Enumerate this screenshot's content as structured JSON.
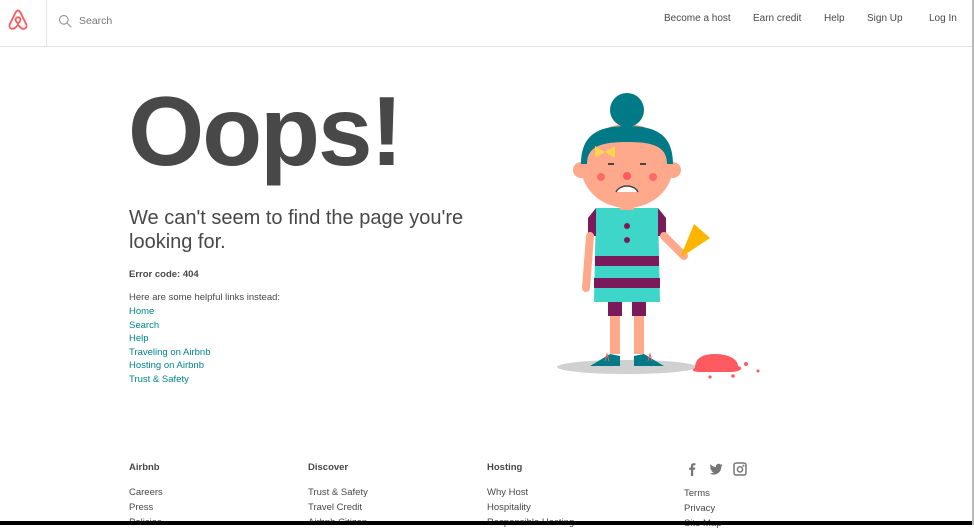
{
  "header": {
    "search_placeholder": "Search",
    "nav": [
      "Become a host",
      "Earn credit",
      "Help",
      "Sign Up",
      "Log In"
    ]
  },
  "error": {
    "headline": "Oops!",
    "message": "We can't seem to find the page you're looking for.",
    "code": "Error code: 404",
    "helpful_text": "Here are some helpful links instead:",
    "links": [
      "Home",
      "Search",
      "Help",
      "Traveling on Airbnb",
      "Hosting on Airbnb",
      "Trust & Safety"
    ]
  },
  "footer": {
    "columns": [
      {
        "heading": "Airbnb",
        "items": [
          "Careers",
          "Press",
          "Policies"
        ]
      },
      {
        "heading": "Discover",
        "items": [
          "Trust & Safety",
          "Travel Credit",
          "Airbnb Citizen"
        ]
      },
      {
        "heading": "Hosting",
        "items": [
          "Why Host",
          "Hospitality",
          "Responsible Hosting"
        ]
      }
    ],
    "social_icons": [
      "facebook-icon",
      "twitter-icon",
      "instagram-icon"
    ],
    "extra_links": [
      "Terms",
      "Privacy",
      "Site Map"
    ]
  },
  "colors": {
    "brand": "#FF5A5F",
    "link": "#008489",
    "text": "#484848"
  }
}
